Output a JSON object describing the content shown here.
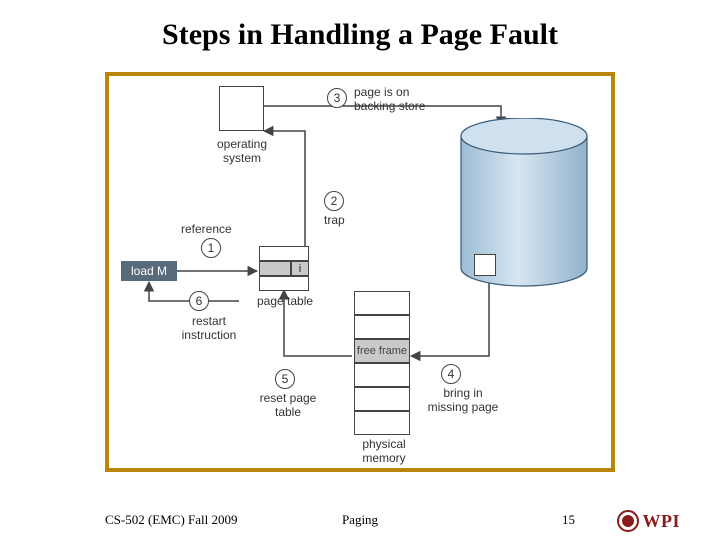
{
  "title": "Steps in Handling a Page Fault",
  "footer": {
    "course": "CS-502 (EMC) Fall 2009",
    "topic": "Paging",
    "page": "15",
    "school": "WPI"
  },
  "labels": {
    "os": "operating\nsystem",
    "reference": "reference",
    "trap": "trap",
    "loadM": "load M",
    "pageTable": "page table",
    "restart": "restart\ninstruction",
    "resetPT": "reset page\ntable",
    "freeFrame": "free frame",
    "bringIn": "bring in\nmissing page",
    "physMem": "physical\nmemory",
    "backingStore": "page is on\nbacking store",
    "invalid_bit": "i"
  },
  "steps": {
    "s1": "1",
    "s2": "2",
    "s3": "3",
    "s4": "4",
    "s5": "5",
    "s6": "6"
  }
}
